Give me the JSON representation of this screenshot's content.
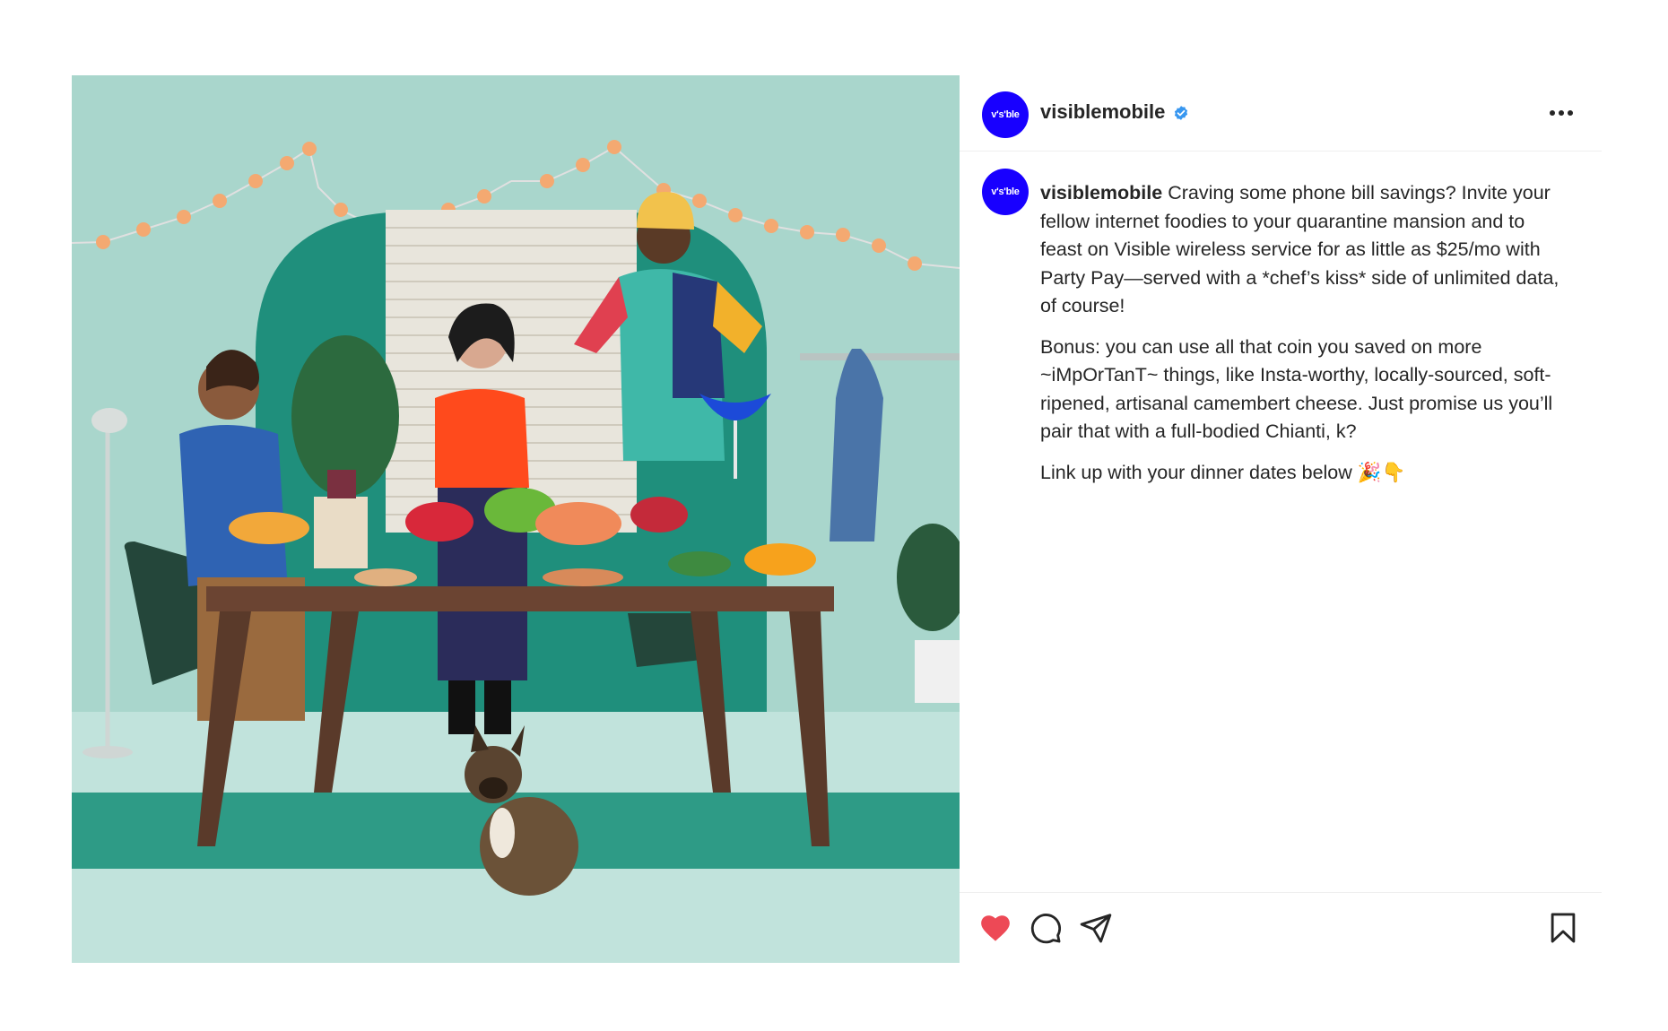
{
  "post": {
    "account": {
      "username": "visiblemobile",
      "avatar_text": "v's'ble",
      "verified": true,
      "brand_color": "#1800ff",
      "verified_color": "#3897f0"
    },
    "header": {
      "more_icon": "more-horizontal-icon"
    },
    "caption": {
      "username": "visiblemobile",
      "paragraph_1": "Craving some phone bill savings? Invite your fellow internet foodies to your quarantine mansion and to feast on Visible wireless service for as little as $25/mo with Party Pay—served with a *chef’s kiss* side of unlimited data, of course!",
      "paragraph_2": "Bonus: you can use all that coin you saved on more ~iMpOrTanT~ things, like Insta-worthy, locally-sourced, soft-ripened, artisanal camembert cheese. Just promise us you’ll pair that with a full-bodied Chianti, k?",
      "paragraph_3": "Link up with your dinner dates below 🎉👇"
    },
    "actions": {
      "like_icon": "heart-filled-icon",
      "like_color": "#ed4956",
      "comment_icon": "comment-icon",
      "share_icon": "share-paper-plane-icon",
      "save_icon": "bookmark-icon"
    },
    "photo": {
      "background_color": "#a9d6cc",
      "arch_color": "#1f8f7c",
      "rug_color": "#2e9b86",
      "table_color": "#5a3a2a"
    }
  }
}
